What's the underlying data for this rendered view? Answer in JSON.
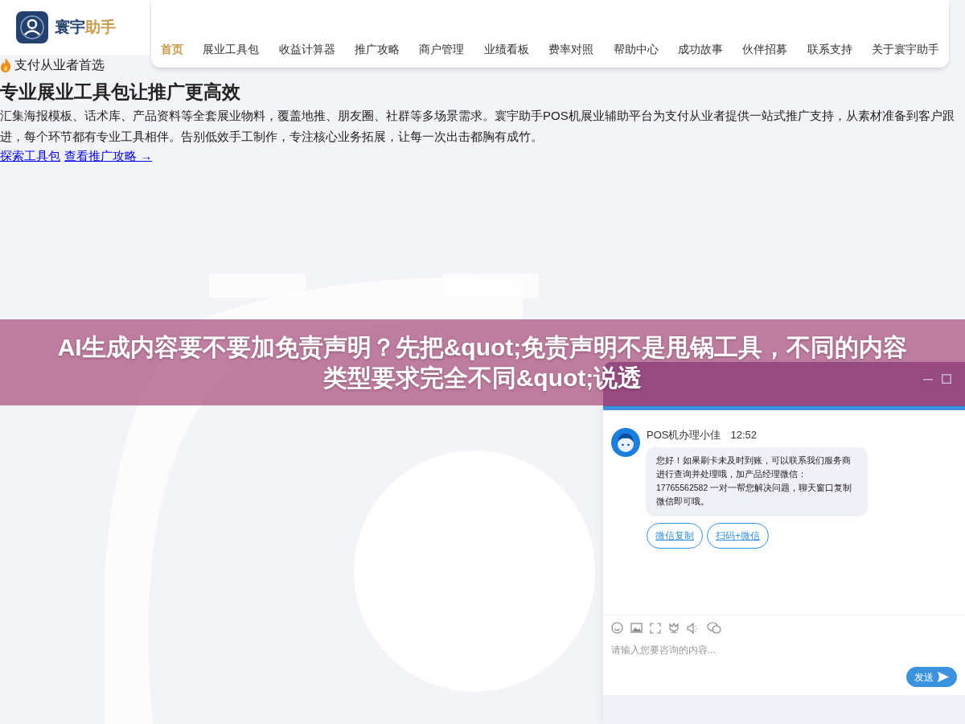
{
  "brand": {
    "name_part1": "寰宇",
    "name_part2": "助手"
  },
  "nav": [
    {
      "label": "首页",
      "selected": true
    },
    {
      "label": "展业工具包",
      "selected": false
    },
    {
      "label": "收益计算器",
      "selected": false
    },
    {
      "label": "推广攻略",
      "selected": false
    },
    {
      "label": "商户管理",
      "selected": false
    },
    {
      "label": "业绩看板",
      "selected": false
    },
    {
      "label": "费率对照",
      "selected": false
    },
    {
      "label": "帮助中心",
      "selected": false
    },
    {
      "label": "成功故事",
      "selected": false
    },
    {
      "label": "伙伴招募",
      "selected": false
    },
    {
      "label": "联系支持",
      "selected": false
    },
    {
      "label": "关于寰宇助手",
      "selected": false
    }
  ],
  "hero": {
    "tagline": "支付从业者首选",
    "heading": "专业展业工具包让推广更高效",
    "description": "汇集海报模板、话术库、产品资料等全套展业物料，覆盖地推、朋友圈、社群等多场景需求。寰宇助手POS机展业辅助平台为支付从业者提供一站式推广支持，从素材准备到客户跟进，每个环节都有专业工具相伴。告别低效手工制作，专注核心业务拓展，让每一次出击都胸有成竹。",
    "links": [
      "探索工具包",
      "查看推广攻略 →"
    ]
  },
  "banner": {
    "title": "AI生成内容要不要加免责声明？先把&quot;免责声明不是甩锅工具，不同的内容类型要求完全不同&quot;说透"
  },
  "chat": {
    "message": {
      "sender": "POS机办理小佳",
      "time": "12:52",
      "text": "您好！如果刷卡未及时到账，可以联系我们服务商进行查询并处理哦，加产品经理微信：17765562582 一对一帮您解决问题，聊天窗口复制微信即可哦。"
    },
    "actions": [
      "微信复制",
      "扫码+微信"
    ],
    "input": {
      "placeholder": "请输入您要咨询的内容..."
    },
    "send": "发送"
  }
}
